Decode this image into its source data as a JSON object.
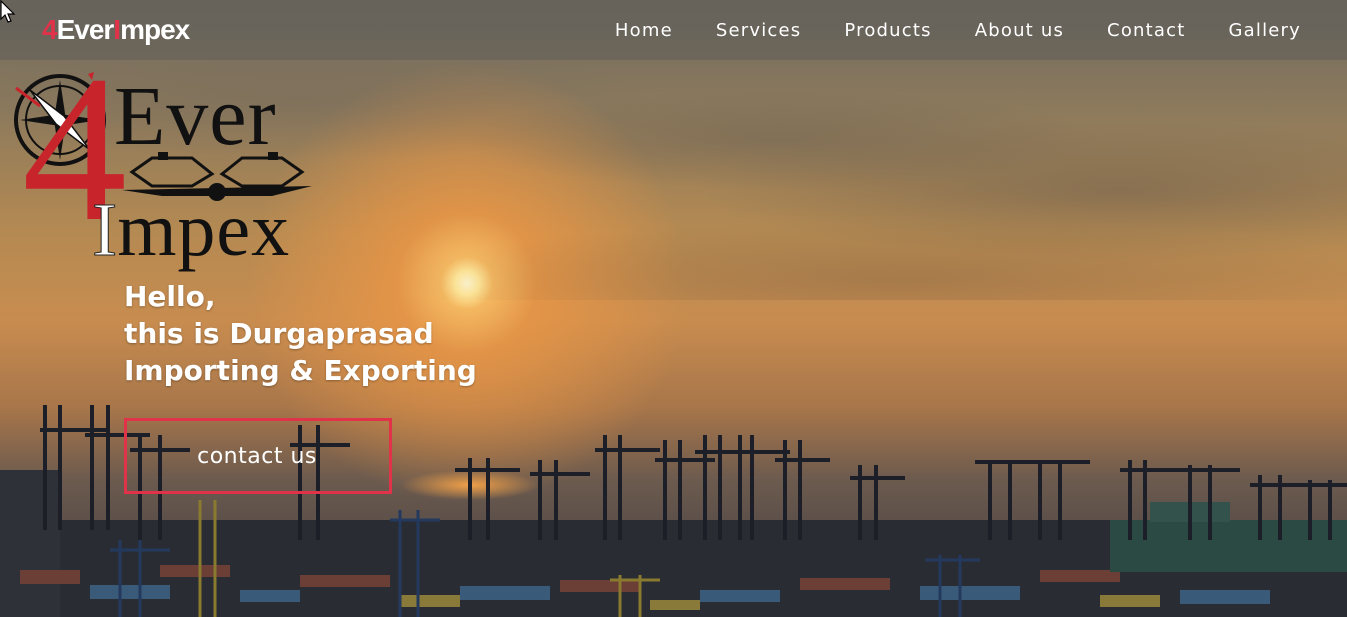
{
  "navbar": {
    "brand": {
      "prefix": "4",
      "part1": "Ever",
      "mark": "I",
      "part2": "mpex"
    },
    "links": [
      {
        "label": "Home"
      },
      {
        "label": "Services"
      },
      {
        "label": "Products"
      },
      {
        "label": "About us"
      },
      {
        "label": "Contact"
      },
      {
        "label": "Gallery"
      }
    ]
  },
  "logo": {
    "four": "4",
    "ever": "Ever",
    "i_mark": "I",
    "impex": "mpex"
  },
  "hero": {
    "lines": [
      "Hello,",
      "this is Durgaprasad",
      "Importing & Exporting"
    ],
    "cta_label": "contact us"
  },
  "colors": {
    "brand_red": "#e0334a",
    "logo_red": "#c8242c",
    "nav_text": "#ffffff"
  },
  "icons": {
    "cursor": "arrow-cursor-icon",
    "compass": "compass-rose-icon",
    "vehicles": "ship-plane-icon"
  }
}
